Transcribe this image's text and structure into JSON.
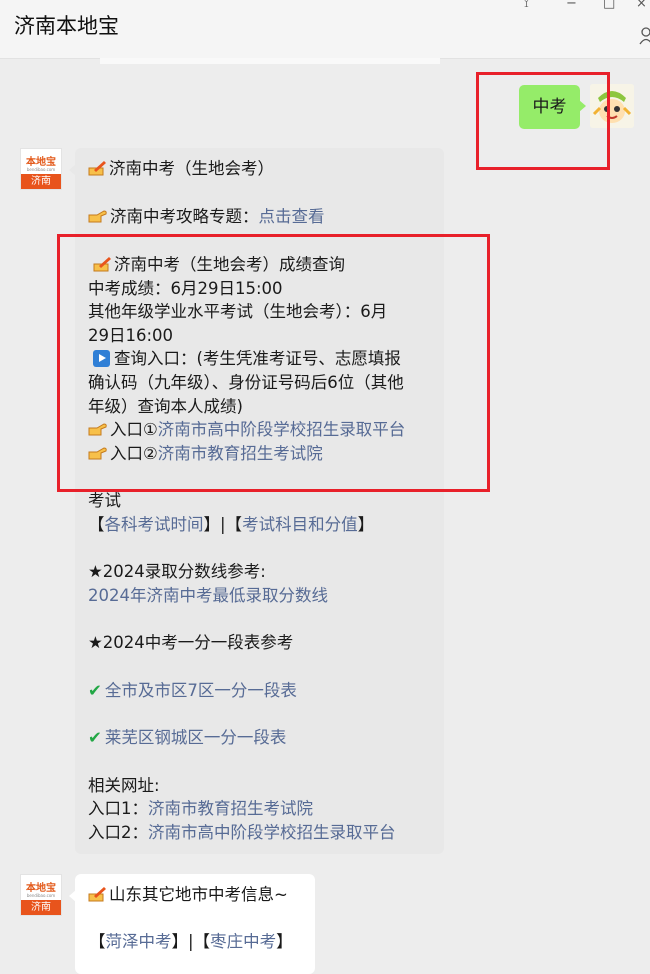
{
  "header": {
    "title": "济南本地宝",
    "controls": [
      "⟟",
      "−",
      "□",
      "×"
    ]
  },
  "sent_message": "中考",
  "logo": {
    "top": "本地宝",
    "url": "bendibao.com",
    "city": "济南"
  },
  "reply": {
    "l1": "济南中考（生地会考）",
    "l2_text": "济南中考攻略专题：",
    "l2_link": "点击查看",
    "l3": "济南中考（生地会考）成绩查询",
    "l4": "中考成绩：6月29日15:00",
    "l5": "其他年级学业水平考试（生地会考）：6月",
    "l6": "29日16:00",
    "l7": "查询入口：(考生凭准考证号、志愿填报",
    "l8": "确认码（九年级）、身份证号码后6位（其他",
    "l9": "年级）查询本人成绩)",
    "l10_text": "入口①",
    "l10_link": "济南市高中阶段学校招生录取平台",
    "l11_text": "入口②",
    "l11_link": "济南市教育招生考试院",
    "l12": "考试",
    "l13_open": "【",
    "l13_link1": "各科考试时间",
    "l13_mid": "】|【",
    "l13_link2": "考试科目和分值",
    "l13_close": "】",
    "l14": "★2024录取分数线参考:",
    "l15_link": "2024年济南中考最低录取分数线",
    "l16": "★2024中考一分一段表参考",
    "l17_link": "全市及市区7区一分一段表",
    "l18_link": "莱芜区钢城区一分一段表",
    "l19": "相关网址:",
    "l20_text": "入口1：",
    "l20_link": "济南市教育招生考试院",
    "l21_text": "入口2：",
    "l21_link": "济南市高中阶段学校招生录取平台"
  },
  "reply2": {
    "l1": "山东其它地市中考信息~",
    "l2_open": "【",
    "l2_link1": "菏泽中考",
    "l2_mid": "】|【",
    "l2_link2": "枣庄中考",
    "l2_close": "】"
  },
  "colors": {
    "link": "#576b95",
    "sent_bubble": "#95ec69",
    "received_bubble": "#e8e8e8",
    "highlight_box": "#e8202a",
    "brand_orange": "#e8541c"
  }
}
